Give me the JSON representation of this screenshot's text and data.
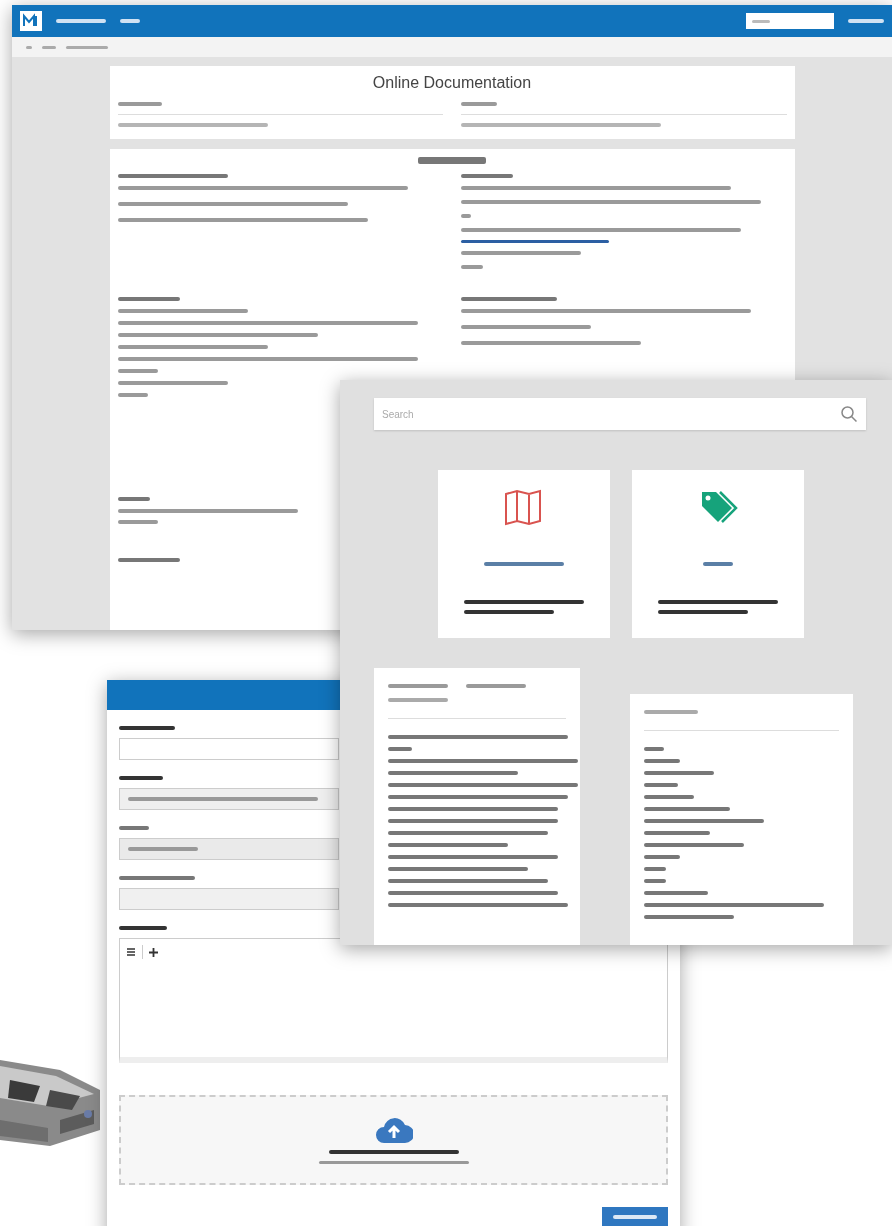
{
  "documentation_window": {
    "page_title": "Online Documentation"
  },
  "catalog_window": {
    "search": {
      "placeholder": "Search"
    },
    "cards": [
      {
        "kind": "map",
        "color": "#d9534f"
      },
      {
        "kind": "tag",
        "color": "#16a37b"
      }
    ]
  }
}
